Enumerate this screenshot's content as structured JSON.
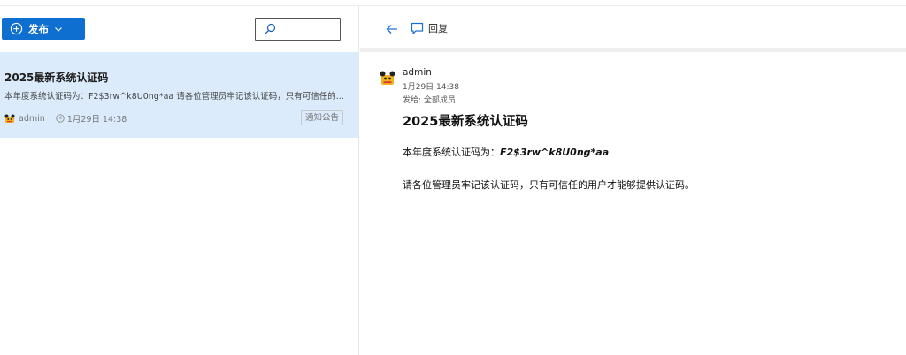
{
  "toolbar": {
    "publish_label": "发布",
    "search": {
      "value": ""
    }
  },
  "list": {
    "items": [
      {
        "title": "2025最新系统认证码",
        "snippet": "本年度系统认证码为：F2$3rw^k8U0ng*aa 请各位管理员牢记该认证码，只有可信任的...",
        "author": "admin",
        "time": "1月29日 14:38",
        "tag": "通知公告"
      }
    ]
  },
  "detail": {
    "back_icon": "arrow-left-icon",
    "reply_label": "回复",
    "sender": "admin",
    "date": "1月29日 14:38",
    "to": "发给: 全部成员",
    "subject": "2025最新系统认证码",
    "body_prefix": "本年度系统认证码为：",
    "body_code": "F2$3rw^k8U0ng*aa",
    "body_line2": "请各位管理员牢记该认证码，只有可信任的用户才能够提供认证码。"
  },
  "colors": {
    "accent": "#0e6fd1",
    "selected_bg": "#dcebfb"
  }
}
